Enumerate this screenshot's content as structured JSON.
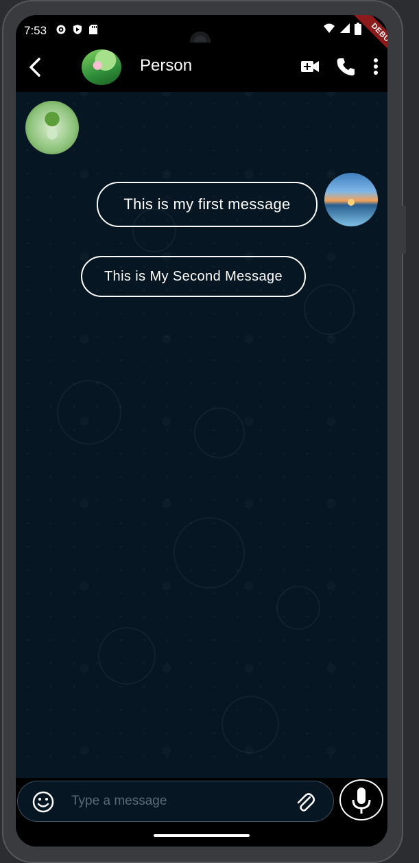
{
  "status_bar": {
    "time": "7:53",
    "left_icons": [
      "gear-icon",
      "shield-icon",
      "sd-card-icon"
    ],
    "right_icons": [
      "wifi-icon",
      "signal-icon",
      "battery-icon"
    ]
  },
  "debug_banner": {
    "label": "DEBUG",
    "color": "#8e1b1b"
  },
  "app_bar": {
    "contact_name": "Person",
    "actions": [
      "video-call-icon",
      "phone-icon",
      "more-vertical-icon"
    ]
  },
  "messages": [
    {
      "text": "This is my first message",
      "side": "left"
    },
    {
      "text": "This is My Second Message",
      "side": "right"
    }
  ],
  "composer": {
    "placeholder": "Type a message",
    "icons": [
      "emoji-icon",
      "attach-icon",
      "mic-icon"
    ]
  },
  "colors": {
    "chat_background": "#061622",
    "bubble_border": "#ffffff",
    "app_bar": "#000000"
  }
}
